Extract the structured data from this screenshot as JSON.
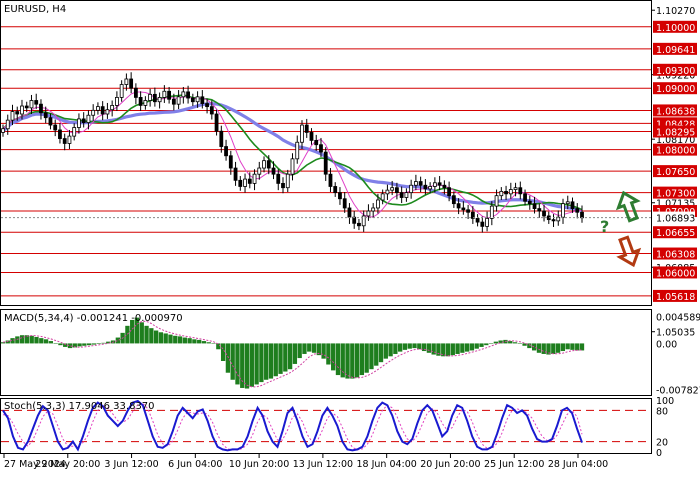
{
  "chart_data": {
    "type": "candlestick",
    "main": {
      "title": "EURUSD, H4",
      "ylim": [
        1.0547,
        1.1042
      ],
      "y_ticks": [
        "1.10270",
        "1.09220",
        "1.08170",
        "1.07135",
        "1.06085",
        "1.05035"
      ],
      "y_tick_values": [
        1.1027,
        1.0922,
        1.0817,
        1.07135,
        1.06085,
        1.05035
      ],
      "current_price": "1.06893",
      "current_price_value": 1.06893,
      "levels": [
        "1.10000",
        "1.09641",
        "1.09300",
        "1.09000",
        "1.08638",
        "1.08428",
        "1.08295",
        "1.08000",
        "1.07650",
        "1.07300",
        "1.07000",
        "1.06655",
        "1.06308",
        "1.06000",
        "1.05618"
      ],
      "x_ticks": [
        "27 May 2024",
        "29 May 20:00",
        "3 Jun 12:00",
        "6 Jun 04:00",
        "10 Jun 20:00",
        "13 Jun 12:00",
        "18 Jun 04:00",
        "20 Jun 20:00",
        "25 Jun 12:00",
        "28 Jun 04:00"
      ],
      "annotation": "?",
      "close": [
        1.0834,
        1.0848,
        1.0862,
        1.0858,
        1.0871,
        1.0868,
        1.088,
        1.0874,
        1.086,
        1.0852,
        1.084,
        1.0832,
        1.0818,
        1.081,
        1.0822,
        1.0836,
        1.085,
        1.0844,
        1.0856,
        1.0864,
        1.087,
        1.0858,
        1.0865,
        1.0872,
        1.0885,
        1.0906,
        1.0915,
        1.09,
        1.0885,
        1.0872,
        1.088,
        1.089,
        1.0878,
        1.0885,
        1.0895,
        1.0882,
        1.0874,
        1.0886,
        1.0894,
        1.0884,
        1.0878,
        1.0886,
        1.0875,
        1.087,
        1.0858,
        1.083,
        1.0805,
        1.079,
        1.077,
        1.075,
        1.074,
        1.0752,
        1.0745,
        1.076,
        1.077,
        1.0782,
        1.077,
        1.076,
        1.0745,
        1.0738,
        1.076,
        1.0785,
        1.0812,
        1.084,
        1.0828,
        1.0815,
        1.0808,
        1.0796,
        1.076,
        1.074,
        1.073,
        1.072,
        1.0705,
        1.069,
        1.068,
        1.0676,
        1.0692,
        1.07,
        1.0705,
        1.0718,
        1.0728,
        1.0734,
        1.0738,
        1.073,
        1.0722,
        1.073,
        1.0742,
        1.0748,
        1.0742,
        1.0736,
        1.074,
        1.0746,
        1.0742,
        1.0738,
        1.0725,
        1.0712,
        1.0705,
        1.0702,
        1.0698,
        1.0688,
        1.0682,
        1.0675,
        1.0688,
        1.0708,
        1.0725,
        1.0732,
        1.0728,
        1.0735,
        1.0738,
        1.0728,
        1.0716,
        1.0712,
        1.0704,
        1.07,
        1.0692,
        1.0686,
        1.0684,
        1.069,
        1.0712,
        1.0715,
        1.0704,
        1.0698,
        1.0689
      ]
    },
    "macd": {
      "label": "MACD(5,34,4) -0.001241 -0.000970",
      "y_ticks": [
        "0.004589",
        "0.00",
        "-0.007827"
      ],
      "y_tick_values": [
        0.004589,
        0,
        -0.007827
      ],
      "ylim": [
        -0.0088,
        0.0057
      ],
      "histogram": [
        0.0002,
        0.0005,
        0.0009,
        0.0012,
        0.0014,
        0.0014,
        0.0013,
        0.0011,
        0.0009,
        0.0007,
        0.0004,
        0.0,
        -0.0003,
        -0.0006,
        -0.0008,
        -0.0007,
        -0.0005,
        -0.0004,
        -0.0003,
        -0.0002,
        -0.0001,
        0.0001,
        0.0003,
        0.0005,
        0.001,
        0.0018,
        0.003,
        0.004,
        0.0044,
        0.0036,
        0.003,
        0.0026,
        0.0022,
        0.0019,
        0.0017,
        0.0015,
        0.0013,
        0.0012,
        0.001,
        0.0009,
        0.0007,
        0.0006,
        0.0004,
        0.0002,
        0.0,
        -0.001,
        -0.003,
        -0.005,
        -0.0062,
        -0.007,
        -0.0076,
        -0.0077,
        -0.0074,
        -0.007,
        -0.0066,
        -0.0062,
        -0.006,
        -0.0056,
        -0.0052,
        -0.0048,
        -0.0044,
        -0.0035,
        -0.0025,
        -0.0018,
        -0.0014,
        -0.0016,
        -0.002,
        -0.0026,
        -0.0036,
        -0.0046,
        -0.0054,
        -0.0058,
        -0.006,
        -0.006,
        -0.0058,
        -0.0054,
        -0.005,
        -0.0044,
        -0.0038,
        -0.0032,
        -0.0026,
        -0.0022,
        -0.0018,
        -0.0014,
        -0.0011,
        -0.0009,
        -0.0008,
        -0.001,
        -0.0013,
        -0.0016,
        -0.0019,
        -0.0021,
        -0.0022,
        -0.0022,
        -0.002,
        -0.0018,
        -0.0016,
        -0.0014,
        -0.0012,
        -0.0009,
        -0.0006,
        -0.0003,
        0.0,
        0.0003,
        0.0005,
        0.0006,
        0.0004,
        0.0002,
        0.0,
        -0.0004,
        -0.0008,
        -0.0012,
        -0.0016,
        -0.0018,
        -0.0019,
        -0.0018,
        -0.0016,
        -0.0013,
        -0.001,
        -0.0011,
        -0.0012,
        -0.0012
      ]
    },
    "stoch": {
      "label": "Stoch(5,3,3) 17.9046 33.8370",
      "y_ticks": [
        "100",
        "80",
        "20",
        "0"
      ],
      "y_tick_values": [
        100,
        80,
        20,
        0
      ],
      "levels": [
        80,
        20
      ],
      "ylim": [
        0,
        100
      ],
      "k": [
        80,
        65,
        30,
        8,
        5,
        20,
        45,
        70,
        88,
        80,
        50,
        20,
        5,
        8,
        20,
        5,
        30,
        60,
        85,
        95,
        88,
        70,
        60,
        50,
        60,
        80,
        95,
        98,
        90,
        60,
        30,
        10,
        8,
        15,
        40,
        70,
        85,
        75,
        65,
        78,
        82,
        60,
        30,
        10,
        5,
        3,
        5,
        5,
        10,
        30,
        60,
        85,
        70,
        40,
        20,
        10,
        40,
        75,
        85,
        60,
        30,
        10,
        15,
        40,
        70,
        85,
        70,
        50,
        20,
        5,
        3,
        5,
        10,
        30,
        60,
        85,
        95,
        90,
        70,
        40,
        20,
        15,
        25,
        55,
        80,
        90,
        80,
        55,
        30,
        40,
        70,
        90,
        85,
        60,
        30,
        10,
        5,
        5,
        10,
        35,
        65,
        90,
        85,
        75,
        80,
        70,
        45,
        25,
        20,
        20,
        25,
        50,
        80,
        85,
        75,
        45,
        18
      ],
      "d": [
        72,
        70,
        55,
        35,
        20,
        11,
        23,
        45,
        68,
        79,
        73,
        50,
        25,
        11,
        11,
        11,
        18,
        32,
        58,
        80,
        89,
        84,
        73,
        60,
        57,
        63,
        78,
        91,
        94,
        83,
        60,
        33,
        16,
        11,
        21,
        42,
        65,
        77,
        75,
        73,
        75,
        73,
        57,
        33,
        15,
        6,
        4,
        4,
        7,
        15,
        33,
        58,
        72,
        65,
        43,
        23,
        23,
        42,
        67,
        73,
        58,
        33,
        18,
        22,
        42,
        65,
        75,
        68,
        47,
        25,
        9,
        4,
        6,
        15,
        33,
        58,
        80,
        90,
        85,
        67,
        43,
        25,
        20,
        32,
        53,
        75,
        83,
        75,
        55,
        42,
        47,
        67,
        82,
        78,
        58,
        33,
        15,
        7,
        7,
        17,
        37,
        63,
        80,
        83,
        80,
        75,
        65,
        47,
        30,
        22,
        22,
        32,
        52,
        72,
        80,
        68,
        34
      ]
    }
  },
  "colors": {
    "candle_body": "#ffffff",
    "candle_outline": "#000000",
    "levels": "#d40000",
    "ma_fast": "#e040c8",
    "ma_mid": "#1d8a1d",
    "ma_slow": "#8080e8",
    "macd_bar": "#1e7e1e",
    "macd_signal": "#d040a0",
    "stoch_k": "#1a1ad0",
    "stoch_d": "#e040c0",
    "arrow_up": "#2e7d32",
    "arrow_down": "#b23a12",
    "annotation": "#2e7d32"
  },
  "icons": [
    "arrow-up-icon",
    "arrow-down-icon"
  ]
}
